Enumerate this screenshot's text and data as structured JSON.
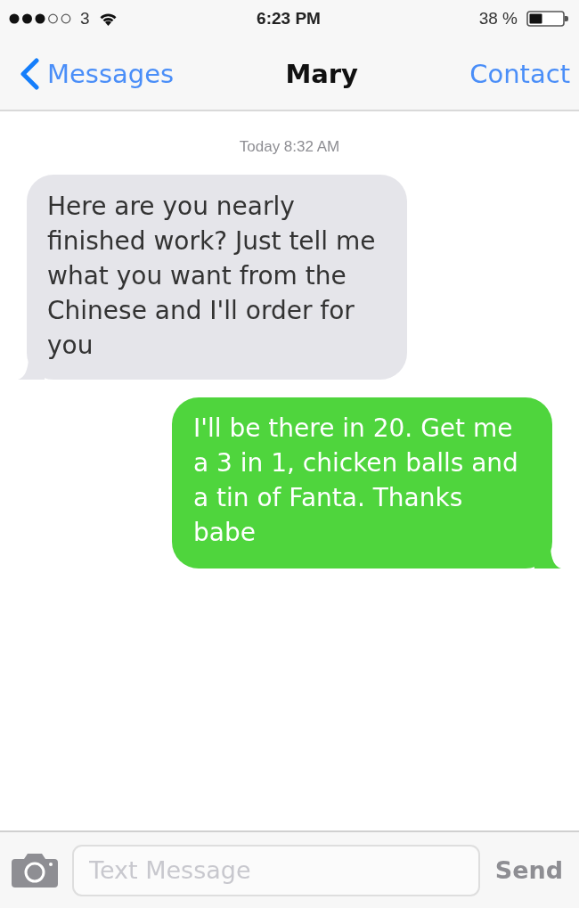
{
  "status_bar": {
    "carrier": "3",
    "time": "6:23 PM",
    "battery": "38 %"
  },
  "nav": {
    "back": "Messages",
    "title": "Mary",
    "action": "Contact"
  },
  "timestamp": "Today 8:32 AM",
  "messages": [
    {
      "kind": "received",
      "text": "Here are you nearly finished work? Just tell me what you want from the Chinese and I'll order for you"
    },
    {
      "kind": "sent",
      "text": "I'll be there in 20. Get me a 3 in 1, chicken balls and a tin of Fanta. Thanks babe"
    }
  ],
  "composer": {
    "placeholder": "Text Message",
    "send": {
      "label": "Send",
      "disabled": true
    }
  }
}
